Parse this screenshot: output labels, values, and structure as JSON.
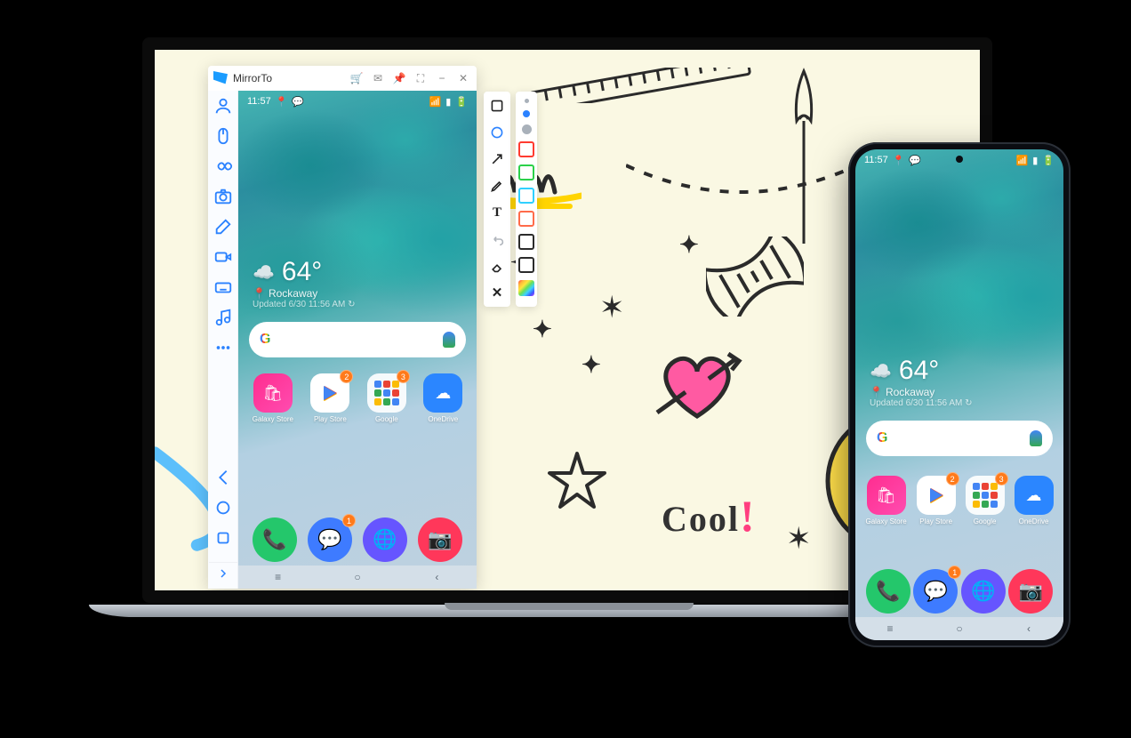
{
  "app": {
    "title": "MirrorTo"
  },
  "phone": {
    "time": "11:57",
    "weather_temp": "64°",
    "location": "Rockaway",
    "updated": "Updated 6/30 11:56 AM ↻",
    "apps": {
      "a1_label": "Galaxy Store",
      "a1_badge": "",
      "a2_label": "Play Store",
      "a2_badge": "2",
      "a3_label": "Google",
      "a3_badge": "3",
      "a4_label": "OneDrive",
      "a4_badge": ""
    },
    "dock_badge": "1"
  },
  "doodles": {
    "cool_text": "Cool",
    "excl": "!"
  },
  "swatches": {
    "c1": "#ff3b30",
    "c2": "#2bd14a",
    "c3": "#30d0ff",
    "c4": "#ff6b4a",
    "c5": "#2b2b2b",
    "c6": "#ffffff"
  }
}
